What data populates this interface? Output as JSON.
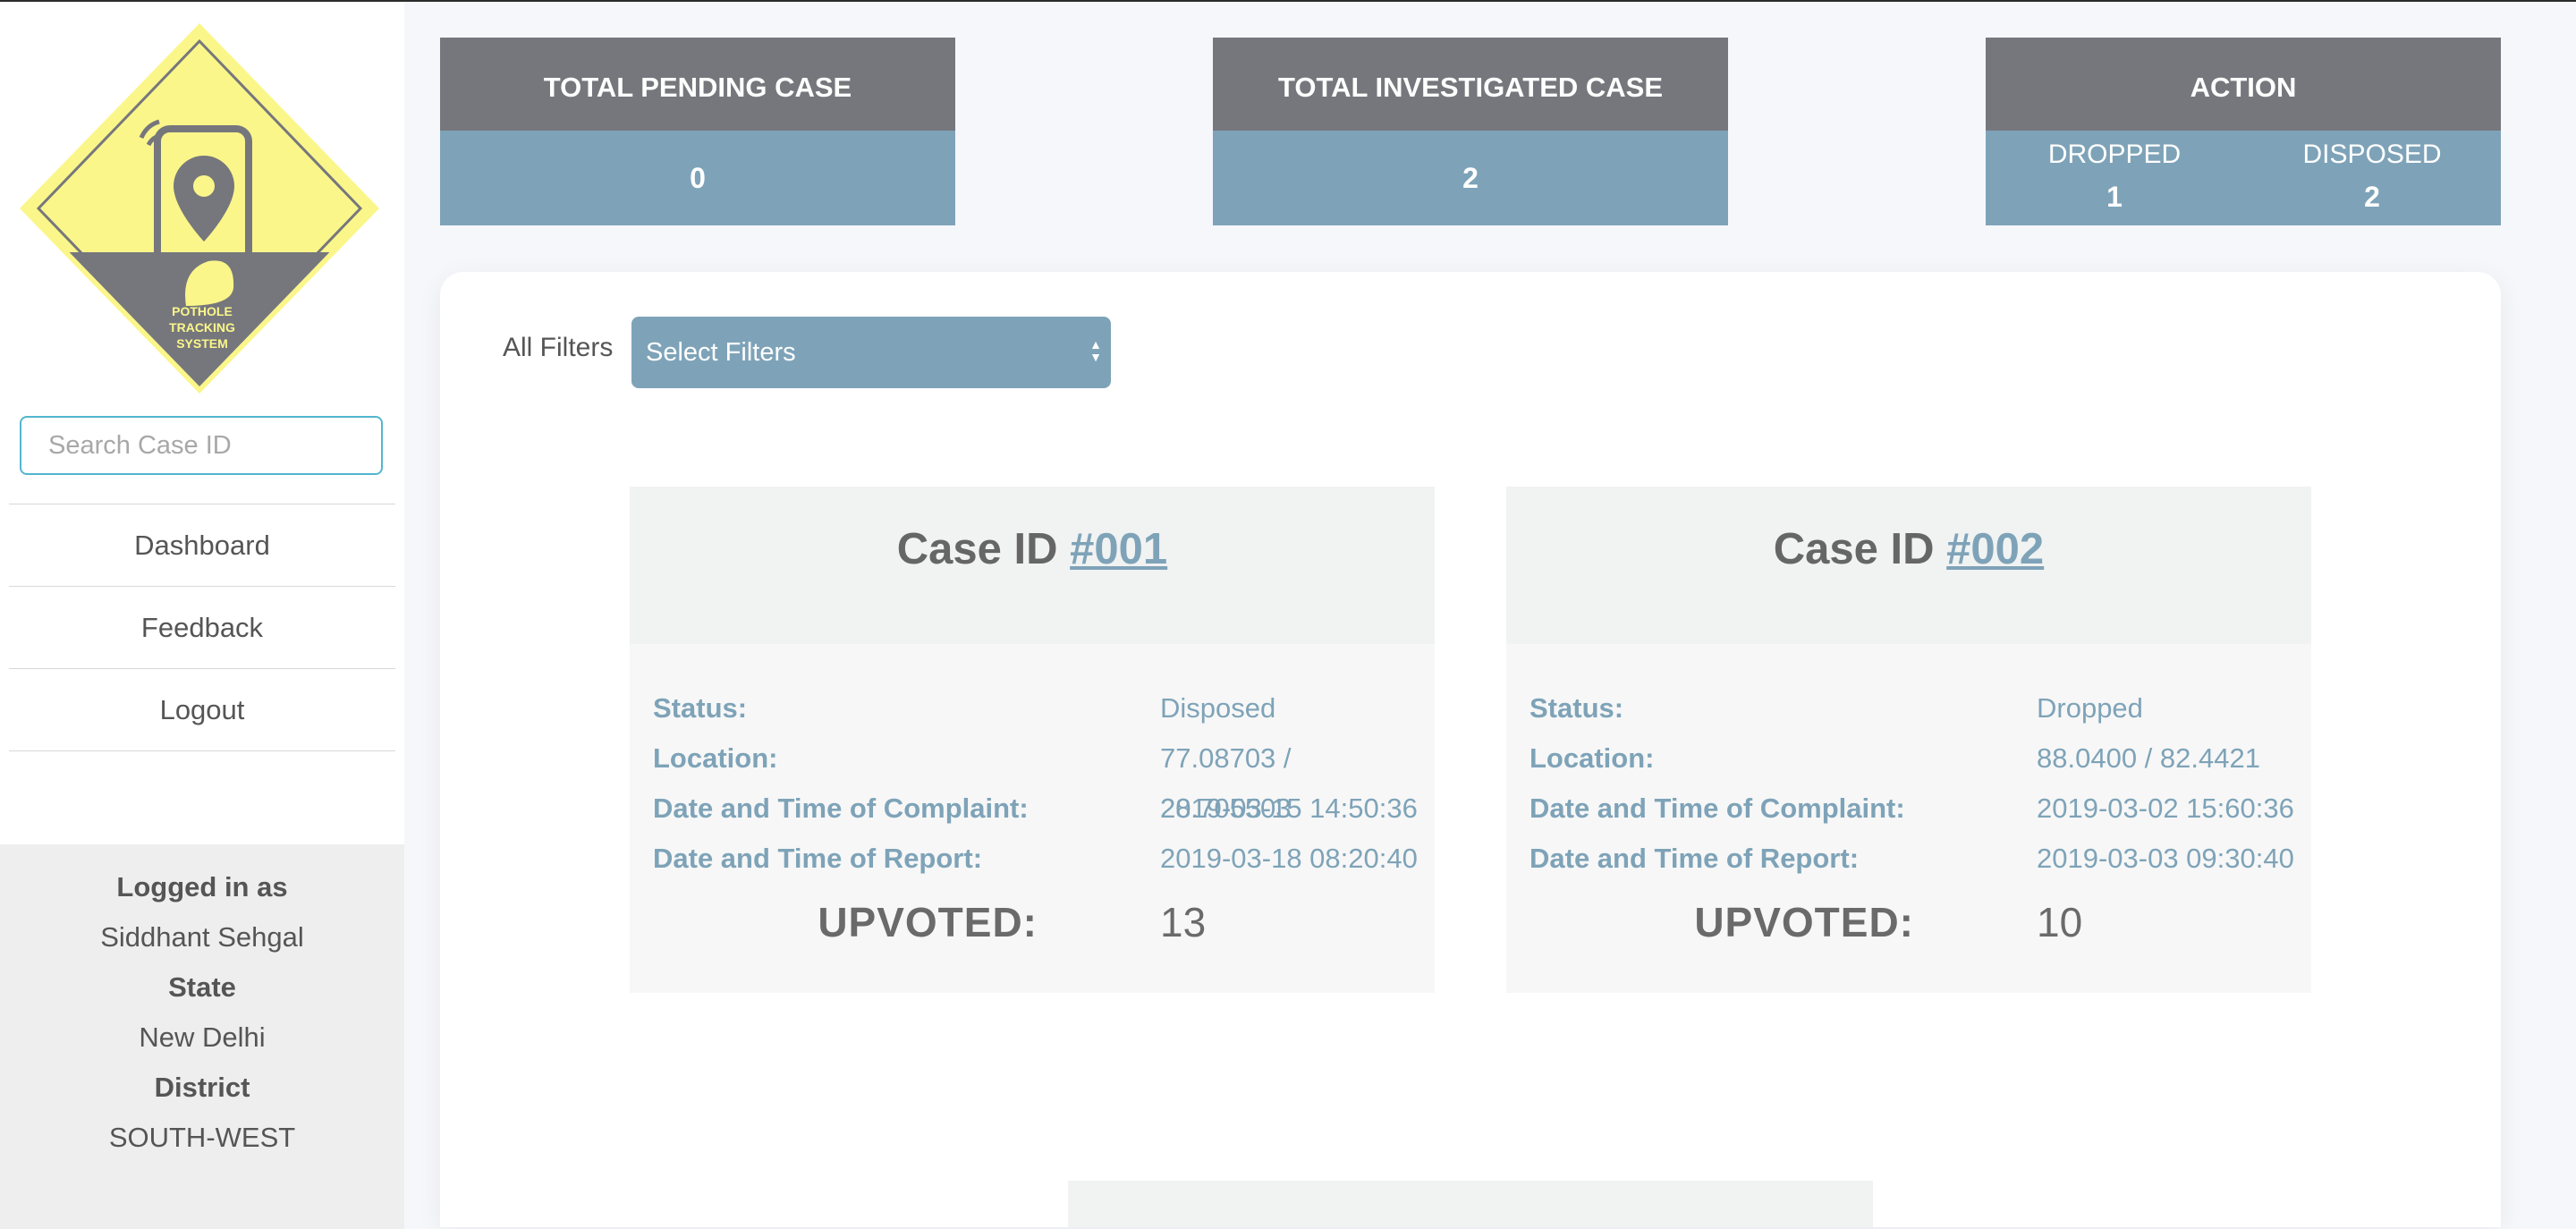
{
  "sidebar": {
    "logo_text": [
      "POTHOLE",
      "TRACKING",
      "SYSTEM"
    ],
    "search": {
      "placeholder": "Search Case ID",
      "value": ""
    },
    "nav": [
      "Dashboard",
      "Feedback",
      "Logout"
    ],
    "user": {
      "logged_in_label": "Logged in as",
      "name": "Siddhant Sehgal",
      "state_label": "State",
      "state": "New Delhi",
      "district_label": "District",
      "district": "SOUTH-WEST"
    }
  },
  "stats": {
    "pending": {
      "label": "TOTAL PENDING CASE",
      "value": "0"
    },
    "investigated": {
      "label": "TOTAL INVESTIGATED CASE",
      "value": "2"
    },
    "action": {
      "label": "ACTION",
      "dropped_label": "DROPPED",
      "dropped": "1",
      "disposed_label": "DISPOSED",
      "disposed": "2"
    }
  },
  "filters": {
    "label": "All Filters",
    "selected": "Select Filters"
  },
  "cases": [
    {
      "title_prefix": "Case ID ",
      "id": "#001",
      "status_label": "Status:",
      "status": "Disposed",
      "location_label": "Location:",
      "location": "77.08703 / 28.705503",
      "complaint_label": "Date and Time of Complaint:",
      "complaint": "2019-03-15 14:50:36",
      "report_label": "Date and Time of Report:",
      "report": "2019-03-18 08:20:40",
      "upvoted_label": "UPVOTED:",
      "upvoted": "13"
    },
    {
      "title_prefix": "Case ID ",
      "id": "#002",
      "status_label": "Status:",
      "status": "Dropped",
      "location_label": "Location:",
      "location": "88.0400 / 82.4421",
      "complaint_label": "Date and Time of Complaint:",
      "complaint": "2019-03-02 15:60:36",
      "report_label": "Date and Time of Report:",
      "report": "2019-03-03 09:30:40",
      "upvoted_label": "UPVOTED:",
      "upvoted": "10"
    }
  ],
  "colors": {
    "stat_header": "#76777c",
    "stat_body": "#7ea3b8",
    "accent": "#7ea3b8",
    "logo_yellow": "#fbf68a",
    "logo_gray": "#76777c",
    "search_border": "#52b6cf"
  }
}
